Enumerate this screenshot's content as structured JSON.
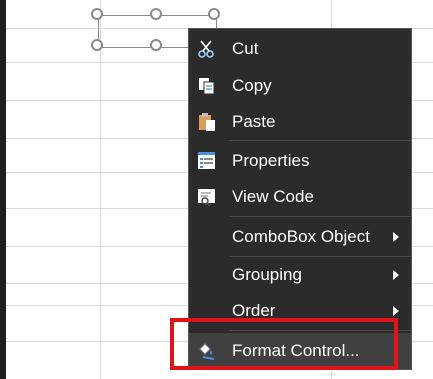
{
  "context_menu": {
    "items": [
      {
        "label": "Cut",
        "icon": "scissors-icon"
      },
      {
        "label": "Copy",
        "icon": "copy-icon"
      },
      {
        "label": "Paste",
        "icon": "paste-icon"
      },
      {
        "label": "Properties",
        "icon": "properties-icon"
      },
      {
        "label": "View Code",
        "icon": "view-code-icon"
      },
      {
        "label": "ComboBox Object",
        "icon": "",
        "submenu": true
      },
      {
        "label": "Grouping",
        "icon": "",
        "submenu": true
      },
      {
        "label": "Order",
        "icon": "",
        "submenu": true
      },
      {
        "label": "Format Control...",
        "icon": "format-control-icon"
      }
    ]
  },
  "colors": {
    "menu_background": "#2b2b2b",
    "highlight_border": "#e0131a"
  }
}
